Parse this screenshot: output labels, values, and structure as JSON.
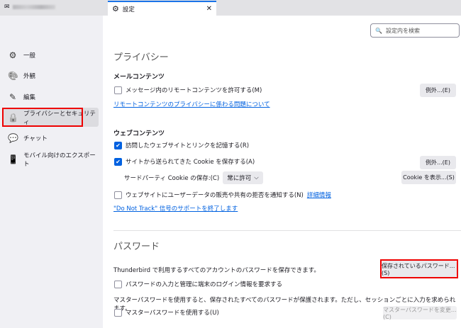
{
  "tabs": {
    "mail_label_blurred": "",
    "settings": "設定",
    "close": "✕"
  },
  "sidebar": {
    "items": [
      {
        "label": "一般",
        "icon": "gear-icon",
        "glyph": "⚙"
      },
      {
        "label": "外観",
        "icon": "palette-icon",
        "glyph": "🎨"
      },
      {
        "label": "編集",
        "icon": "pencil-icon",
        "glyph": "✎"
      },
      {
        "label": "プライバシーとセキュリティ",
        "icon": "lock-icon",
        "glyph": "🔒",
        "selected": true
      },
      {
        "label": "チャット",
        "icon": "chat-icon",
        "glyph": "💬"
      },
      {
        "label": "モバイル向けのエクスポート",
        "icon": "mobile-icon",
        "glyph": "📱"
      }
    ]
  },
  "search": {
    "placeholder": "設定内を検索"
  },
  "privacy": {
    "title": "プライバシー",
    "mail": {
      "heading": "メールコンテンツ",
      "remote": "メッセージ内のリモートコンテンツを許可する(M)",
      "remote_checked": false,
      "exceptions": "例外...(E)",
      "link": "リモートコンテンツのプライバシーに係わる問題について"
    },
    "web": {
      "heading": "ウェブコンテンツ",
      "history": "訪問したウェブサイトとリンクを記憶する(R)",
      "history_checked": true,
      "cookies": "サイトから送られてきた Cookie を保存する(A)",
      "cookies_checked": true,
      "exceptions": "例外...(E)",
      "third_party_label": "サードパーティ Cookie の保存:(C)",
      "third_party_value": "常に許可",
      "show_cookies": "Cookie を表示...(S)",
      "dnt": "ウェブサイトにユーザーデータの販売や共有の拒否を通知する(N)",
      "dnt_checked": false,
      "learn_more": "詳細情報",
      "dnt_link": "\"Do Not Track\" 信号のサポートを終了します"
    }
  },
  "passwords": {
    "title": "パスワード",
    "desc": "Thunderbird で利用するすべてのアカウントのパスワードを保存できます。",
    "saved_button": "保存されているパスワード...(S)",
    "os_auth": "パスワードの入力と管理に端末のログイン情報を要求する",
    "os_auth_checked": false,
    "master_desc": "マスターパスワードを使用すると、保存されたすべてのパスワードが保護されます。ただし、セッションごとに入力を求められます。",
    "use_master": "マスターパスワードを使用する(U)",
    "use_master_checked": false,
    "change_master": "マスターパスワードを変更...(C)"
  },
  "colors": {
    "accent": "#0061e0",
    "highlight": "#ee0000"
  }
}
